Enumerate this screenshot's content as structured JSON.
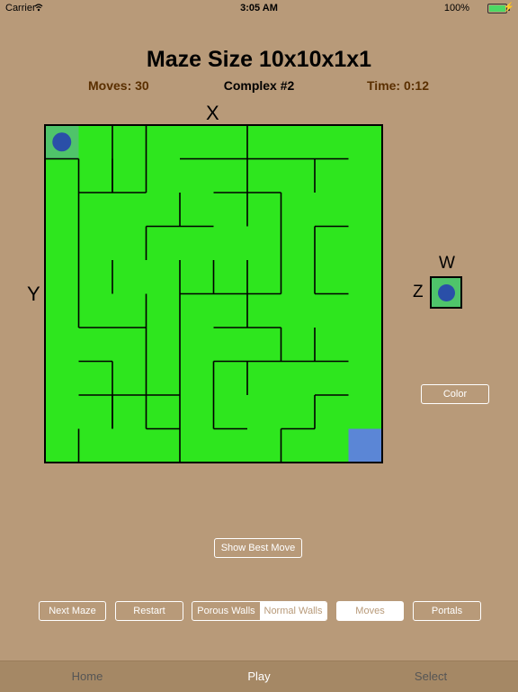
{
  "status_bar": {
    "carrier": "Carrier",
    "time": "3:05 AM",
    "battery": "100%"
  },
  "header": {
    "title": "Maze Size 10x10x1x1",
    "moves": "Moves: 30",
    "level": "Complex #2",
    "time": "Time: 0:12"
  },
  "axes": {
    "x": "X",
    "y": "Y",
    "w": "W",
    "z": "Z"
  },
  "maze": {
    "cols": 10,
    "rows": 10,
    "floor_color": "#2ee61e",
    "start_cell_color": "#4fc46a",
    "goal_cell_color": "#5b86d6",
    "player_color": "#2a4fa8",
    "player_cell": [
      0,
      0
    ],
    "goal_cell": [
      9,
      9
    ]
  },
  "buttons": {
    "color": "Color",
    "show_best_move": "Show Best Move",
    "next_maze": "Next Maze",
    "restart": "Restart",
    "porous_walls": "Porous Walls",
    "normal_walls": "Normal Walls",
    "moves": "Moves",
    "portals": "Portals"
  },
  "tabs": {
    "home": "Home",
    "play": "Play",
    "select": "Select"
  }
}
